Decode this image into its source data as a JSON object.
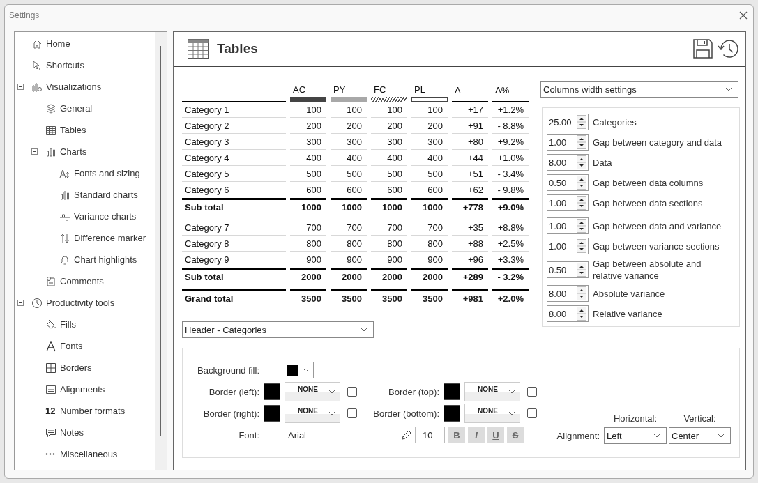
{
  "window": {
    "title": "Settings"
  },
  "sidebar": {
    "items": [
      {
        "label": "Home"
      },
      {
        "label": "Shortcuts"
      },
      {
        "label": "Visualizations",
        "expanded": true,
        "children": [
          {
            "label": "General"
          },
          {
            "label": "Tables"
          },
          {
            "label": "Charts",
            "expanded": true,
            "children": [
              {
                "label": "Fonts and sizing"
              },
              {
                "label": "Standard charts"
              },
              {
                "label": "Variance charts"
              },
              {
                "label": "Difference marker"
              },
              {
                "label": "Chart highlights"
              }
            ]
          },
          {
            "label": "Comments"
          }
        ]
      },
      {
        "label": "Productivity tools",
        "expanded": true,
        "children": [
          {
            "label": "Fills"
          },
          {
            "label": "Fonts"
          },
          {
            "label": "Borders"
          },
          {
            "label": "Alignments"
          },
          {
            "label": "Number formats",
            "icon_text": "12"
          },
          {
            "label": "Notes"
          },
          {
            "label": "Miscellaneous"
          }
        ]
      }
    ]
  },
  "page": {
    "title": "Tables"
  },
  "preview": {
    "columns": [
      {
        "label": "AC",
        "kind": "solid-dark"
      },
      {
        "label": "PY",
        "kind": "solid-light"
      },
      {
        "label": "FC",
        "kind": "hatched"
      },
      {
        "label": "PL",
        "kind": "outline"
      },
      {
        "label": "Δ",
        "kind": "plain"
      },
      {
        "label": "Δ%",
        "kind": "plain"
      }
    ],
    "rows": [
      {
        "kind": "category",
        "label": "Category 1",
        "values": [
          "100",
          "100",
          "100",
          "100",
          "+17",
          "+1.2%"
        ]
      },
      {
        "kind": "category",
        "label": "Category 2",
        "values": [
          "200",
          "200",
          "200",
          "200",
          "+91",
          "- 8.8%"
        ]
      },
      {
        "kind": "category",
        "label": "Category 3",
        "values": [
          "300",
          "300",
          "300",
          "300",
          "+80",
          "+9.2%"
        ]
      },
      {
        "kind": "category",
        "label": "Category 4",
        "values": [
          "400",
          "400",
          "400",
          "400",
          "+44",
          "+1.0%"
        ]
      },
      {
        "kind": "category",
        "label": "Category 5",
        "values": [
          "500",
          "500",
          "500",
          "500",
          "+51",
          "- 3.4%"
        ]
      },
      {
        "kind": "category",
        "label": "Category 6",
        "values": [
          "600",
          "600",
          "600",
          "600",
          "+62",
          "- 9.8%"
        ]
      },
      {
        "kind": "subtotal",
        "label": "Sub total",
        "values": [
          "1000",
          "1000",
          "1000",
          "1000",
          "+778",
          "+9.0%"
        ]
      },
      {
        "kind": "category",
        "label": "Category 7",
        "values": [
          "700",
          "700",
          "700",
          "700",
          "+35",
          "+8.8%"
        ]
      },
      {
        "kind": "category",
        "label": "Category 8",
        "values": [
          "800",
          "800",
          "800",
          "800",
          "+88",
          "+2.5%"
        ]
      },
      {
        "kind": "category",
        "label": "Category 9",
        "values": [
          "900",
          "900",
          "900",
          "900",
          "+96",
          "+3.3%"
        ]
      },
      {
        "kind": "subtotal",
        "label": "Sub total",
        "values": [
          "2000",
          "2000",
          "2000",
          "2000",
          "+289",
          "- 3.2%"
        ]
      },
      {
        "kind": "total",
        "label": "Grand total",
        "values": [
          "3500",
          "3500",
          "3500",
          "3500",
          "+981",
          "+2.0%"
        ]
      }
    ]
  },
  "width_settings": {
    "dropdown": "Columns width settings",
    "groups": [
      [
        {
          "value": "25.00",
          "label": "Categories"
        },
        {
          "value": "1.00",
          "label": "Gap between category and data"
        },
        {
          "value": "8.00",
          "label": "Data"
        },
        {
          "value": "0.50",
          "label": "Gap between data columns"
        },
        {
          "value": "1.00",
          "label": "Gap between data sections"
        }
      ],
      [
        {
          "value": "1.00",
          "label": "Gap between data and variance"
        },
        {
          "value": "1.00",
          "label": "Gap between variance sections"
        },
        {
          "value": "0.50",
          "label": "Gap between absolute and relative variance"
        },
        {
          "value": "8.00",
          "label": "Absolute variance"
        },
        {
          "value": "8.00",
          "label": "Relative variance"
        }
      ]
    ]
  },
  "element_dropdown": "Header - Categories",
  "format": {
    "background_fill": {
      "label": "Background fill:",
      "swatch": {
        "color": "#ffffff"
      },
      "picker": {
        "color": "#000000"
      }
    },
    "borders": [
      {
        "label": "Border (left):",
        "color": "#000000",
        "style": "NONE",
        "checked": false
      },
      {
        "label": "Border (top):",
        "color": "#000000",
        "style": "NONE",
        "checked": false
      },
      {
        "label": "Border (right):",
        "color": "#000000",
        "style": "NONE",
        "checked": false
      },
      {
        "label": "Border (bottom):",
        "color": "#000000",
        "style": "NONE",
        "checked": false
      }
    ],
    "font": {
      "label": "Font:",
      "swatch": {
        "color": "#ffffff"
      },
      "name": "Arial",
      "size": "10",
      "styles": [
        {
          "label": "B",
          "disabled": true
        },
        {
          "label": "I",
          "disabled": true
        },
        {
          "label": "U",
          "disabled": true
        },
        {
          "label": "S",
          "disabled": true
        }
      ]
    },
    "alignment": {
      "label": "Alignment:",
      "horizontal": {
        "label": "Horizontal:",
        "value": "Left"
      },
      "vertical": {
        "label": "Vertical:",
        "value": "Center"
      }
    }
  }
}
